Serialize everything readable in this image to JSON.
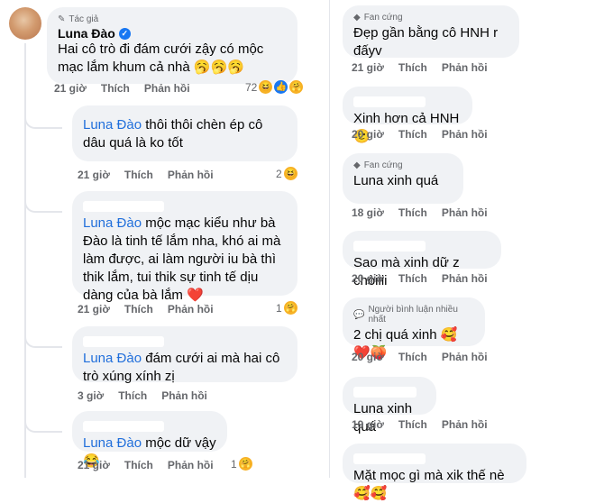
{
  "left": {
    "main": {
      "badge": "Tác giả",
      "author": "Luna Đào",
      "text": "Hai cô trò đi đám cưới zậy có mộc mạc lắm khum cả nhà 🥱🥱🥱",
      "time": "21 giờ",
      "like": "Thích",
      "reply": "Phản hồi",
      "react_count": "72"
    },
    "replies": [
      {
        "mention": "Luna Đào",
        "text": " thôi thôi chèn ép cô dâu quá là ko tốt",
        "time": "21 giờ",
        "like": "Thích",
        "reply": "Phản hồi",
        "react_count": "2"
      },
      {
        "mention": "Luna Đào",
        "text": " mộc mạc kiểu như bà Đào là tinh tế lắm nha, khó ai mà làm được, ai làm người iu bà thì thik lắm, tui thik sự tinh tế dịu dàng của bà lắm ❤️",
        "time": "21 giờ",
        "like": "Thích",
        "reply": "Phản hồi",
        "react_count": "1"
      },
      {
        "mention": "Luna Đào",
        "text": " đám cưới ai mà hai cô trò xúng xính zị",
        "time": "3 giờ",
        "like": "Thích",
        "reply": "Phản hồi",
        "react_count": ""
      },
      {
        "mention": "Luna Đào",
        "text": " mộc dữ vậy😂",
        "time": "21 giờ",
        "like": "Thích",
        "reply": "Phản hồi",
        "react_count": "1"
      }
    ]
  },
  "right": [
    {
      "badge": "Fan cứng",
      "text": "Đẹp gần bằng cô HNH r đấyv",
      "time": "21 giờ",
      "like": "Thích",
      "reply": "Phản hồi"
    },
    {
      "badge": "",
      "text": "Xinh hơn cả HNH 🙂",
      "time": "20 giờ",
      "like": "Thích",
      "reply": "Phản hồi"
    },
    {
      "badge": "Fan cứng",
      "text": "Luna xinh quá",
      "time": "18 giờ",
      "like": "Thích",
      "reply": "Phản hồi"
    },
    {
      "badge": "",
      "text": "Sao mà xinh dữ z chòiiii",
      "time": "20 giờ",
      "like": "Thích",
      "reply": "Phản hồi"
    },
    {
      "badge": "Người bình luận nhiều nhất",
      "text": "2 chị quá xinh 🥰❤️🍑",
      "time": "20 giờ",
      "like": "Thích",
      "reply": "Phản hồi"
    },
    {
      "badge": "",
      "text": "Luna xinh quá",
      "time": "19 giờ",
      "like": "Thích",
      "reply": "Phản hồi"
    },
    {
      "badge": "",
      "text": "Mặt mọc gì mà xik thế nè🥰🥰",
      "time": "",
      "like": "",
      "reply": ""
    }
  ],
  "icons": {
    "badge_left": "pencil-icon",
    "badge_fan": "diamond-icon",
    "badge_top": "chat-bubble-icon",
    "verified": "verified-check-icon"
  },
  "colors": {
    "bubble": "#f0f2f5",
    "mention": "#216fdb",
    "meta": "#65676b",
    "verified": "#1877f2"
  }
}
